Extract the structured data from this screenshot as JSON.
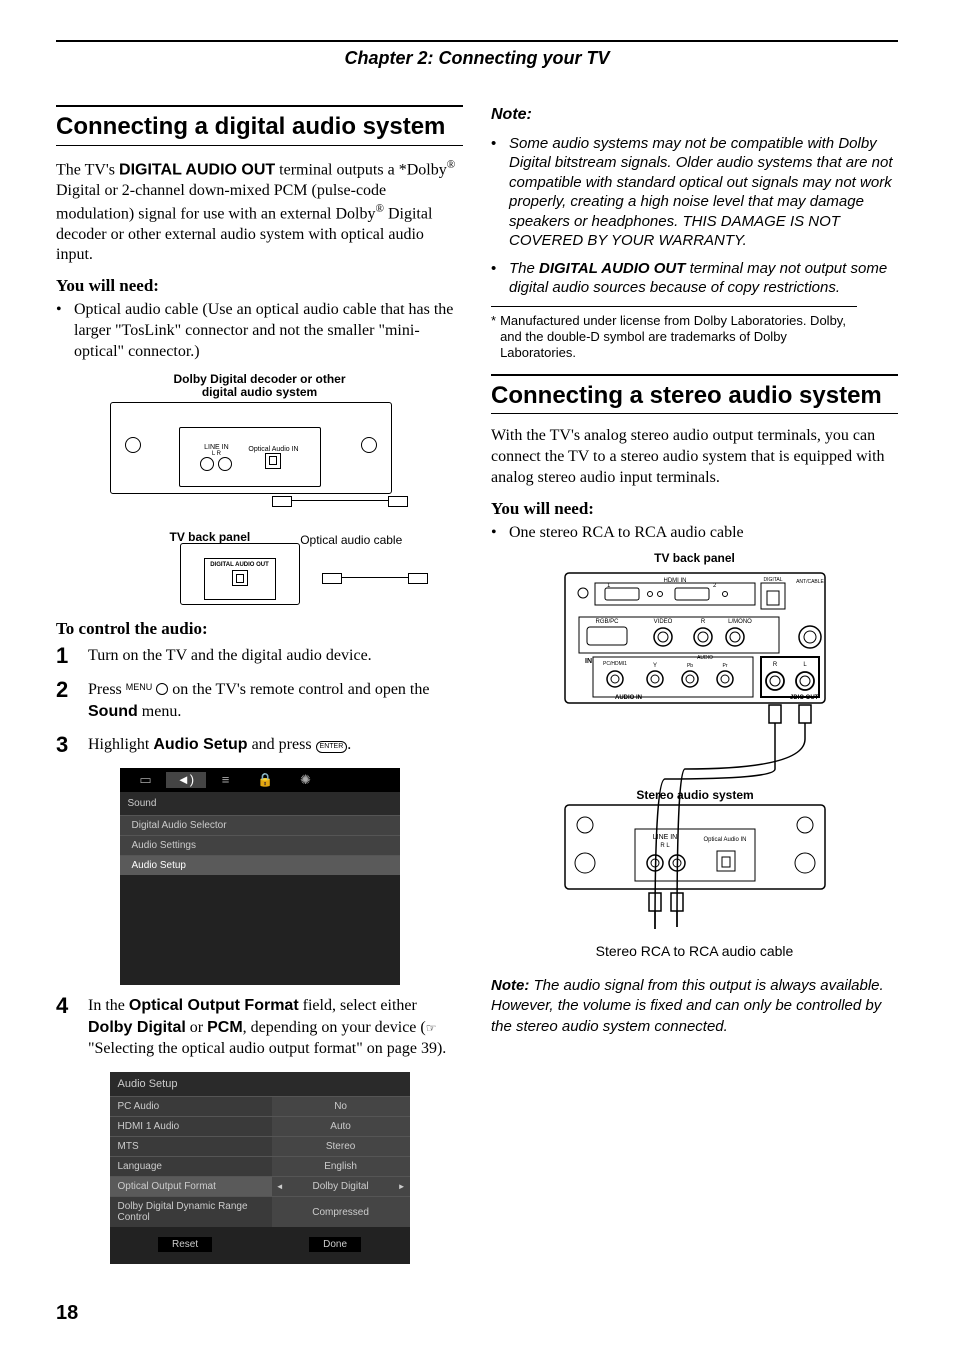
{
  "chapter": "Chapter 2: Connecting your TV",
  "left": {
    "title": "Connecting a digital audio system",
    "intro1a": "The TV's ",
    "intro1b": "DIGITAL AUDIO OUT",
    "intro1c": " terminal outputs a *Dolby",
    "intro1d": " Digital or 2-channel down-mixed PCM (pulse-code modulation) signal for use with an external Dolby",
    "intro1e": " Digital decoder or other external audio system with optical audio input.",
    "need_head": "You will need:",
    "need_item": "Optical audio cable (Use an optical audio cable that has the larger \"TosLink\" connector and not the smaller \"mini-optical\" connector.)",
    "diag1_decoder": "Dolby Digital decoder or other digital audio system",
    "diag1_linein": "LINE IN",
    "diag1_lr": "L    R",
    "diag1_optin": "Optical Audio IN",
    "diag1_tv": "TV back panel",
    "diag1_cable": "Optical audio cable",
    "diag1_digout": "DIGITAL AUDIO OUT",
    "control_head": "To control the audio:",
    "step1": "Turn on the TV and the digital audio device.",
    "step2a": "Press ",
    "step2_menu": "MENU",
    "step2b": " on the TV's remote control and open the ",
    "step2_sound": "Sound",
    "step2c": " menu.",
    "step3a": "Highlight ",
    "step3_audio": "Audio Setup",
    "step3b": " and press ",
    "step3_enter": "ENTER",
    "step3c": ".",
    "menu1": {
      "title": "Sound",
      "rows": [
        "Digital Audio Selector",
        "Audio Settings",
        "Audio Setup"
      ]
    },
    "step4a": "In the ",
    "step4_oof": "Optical Output Format",
    "step4b": " field, select either ",
    "step4_dd": "Dolby Digital",
    "step4c": " or ",
    "step4_pcm": "PCM",
    "step4d": ", depending on your device (",
    "step4e": " \"Selecting the optical audio output format\" on page 39).",
    "menu2": {
      "title": "Audio Setup",
      "rows": [
        {
          "l": "PC Audio",
          "r": "No"
        },
        {
          "l": "HDMI 1 Audio",
          "r": "Auto"
        },
        {
          "l": "MTS",
          "r": "Stereo"
        },
        {
          "l": "Language",
          "r": "English"
        },
        {
          "l": "Optical Output Format",
          "r": "Dolby Digital",
          "sel": true
        },
        {
          "l": "Dolby Digital Dynamic Range Control",
          "r": "Compressed",
          "tall": true
        }
      ],
      "btn1": "Reset",
      "btn2": "Done"
    }
  },
  "right": {
    "note_head": "Note:",
    "note1a": "Some audio systems may not be compatible with Dolby Digital bitstream signals. Older audio systems that are not compatible with standard optical out signals may not work properly, creating a high noise level that may damage speakers or headphones. THIS DAMAGE IS NOT COVERED BY YOUR WARRANTY.",
    "note2a": "The ",
    "note2b": "DIGITAL AUDIO OUT",
    "note2c": " terminal may not output some digital audio sources because of copy restrictions.",
    "footnote": "Manufactured under license from Dolby Laboratories. Dolby, and the double-D symbol are trademarks of Dolby Laboratories.",
    "title2": "Connecting a stereo audio system",
    "intro2": "With the TV's analog stereo audio output terminals, you can connect the TV to a stereo audio system that is equipped with analog stereo audio input terminals.",
    "need2_head": "You will need:",
    "need2_item": "One stereo RCA to RCA audio cable",
    "diag2_tv": "TV back panel",
    "diag2_stereo": "Stereo audio system",
    "diag2_linein": "LINE IN",
    "diag2_optin": "Optical Audio IN",
    "diag2_cable": "Stereo RCA to RCA audio cable",
    "note3_head": "Note:",
    "note3": " The audio signal from this output is always available. However, the volume is fixed and can only be controlled by the stereo audio system connected."
  },
  "page": "18"
}
